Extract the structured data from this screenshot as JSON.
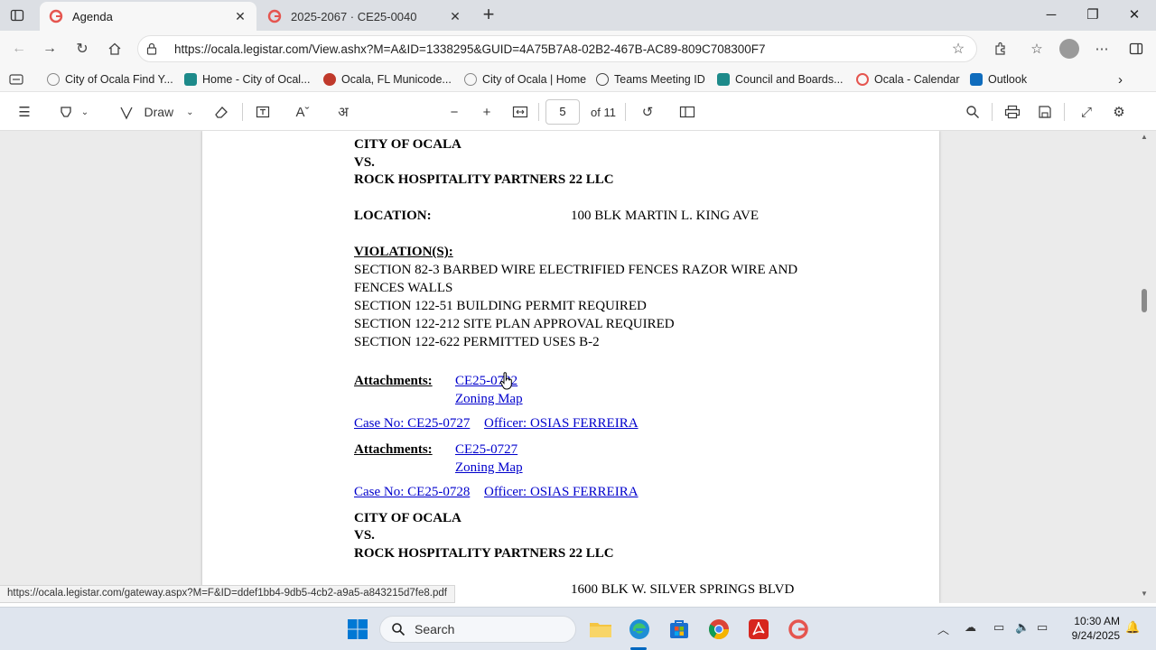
{
  "browser": {
    "tabs": [
      {
        "title": "Agenda",
        "active": true
      },
      {
        "title": "2025-2067 · CE25-0040",
        "active": false
      }
    ],
    "url": "https://ocala.legistar.com/View.ashx?M=A&ID=1338295&GUID=4A75B7A8-02B2-467B-AC89-809C708300F7",
    "favorites": [
      {
        "label": "City of Ocala  Find Y...",
        "icon": "ocala-icon"
      },
      {
        "label": "Home - City of Ocal...",
        "icon": "teams-icon"
      },
      {
        "label": "Ocala, FL  Municode...",
        "icon": "municode-icon"
      },
      {
        "label": "City of Ocala | Home",
        "icon": "ocala-icon"
      },
      {
        "label": "Teams Meeting ID",
        "icon": "globe-icon"
      },
      {
        "label": "Council and Boards...",
        "icon": "teams-icon"
      },
      {
        "label": "Ocala - Calendar",
        "icon": "google-icon"
      },
      {
        "label": "Outlook",
        "icon": "outlook-icon"
      }
    ]
  },
  "pdf_toolbar": {
    "draw_label": "Draw",
    "page_current": "5",
    "page_total": "of 11"
  },
  "document": {
    "case1": {
      "party1": "CITY OF OCALA",
      "vs": "VS.",
      "party2": "ROCK HOSPITALITY PARTNERS 22 LLC",
      "location_label": "LOCATION:",
      "location_value": "100 BLK MARTIN L. KING AVE",
      "violations_label": "VIOLATION(S):",
      "violations": [
        "SECTION 82-3 BARBED WIRE ELECTRIFIED FENCES RAZOR WIRE AND",
        "FENCES WALLS",
        "SECTION 122-51 BUILDING PERMIT REQUIRED",
        "SECTION 122-212 SITE PLAN APPROVAL REQUIRED",
        "SECTION 122-622 PERMITTED USES B-2"
      ],
      "attachments_label": "Attachments:",
      "attachment1": "CE25-0722",
      "attachment2": "Zoning Map"
    },
    "case2": {
      "case_no": "Case No: CE25-0727",
      "officer": "Officer: OSIAS FERREIRA",
      "attachments_label": "Attachments:",
      "attachment1": "CE25-0727",
      "attachment2": "Zoning Map"
    },
    "case3": {
      "case_no": "Case No: CE25-0728",
      "officer": "Officer: OSIAS FERREIRA",
      "party1": "CITY OF OCALA",
      "vs": "VS.",
      "party2": "ROCK HOSPITALITY PARTNERS 22 LLC",
      "location_value": "1600 BLK W. SILVER SPRINGS BLVD"
    }
  },
  "status_url": "https://ocala.legistar.com/gateway.aspx?M=F&ID=ddef1bb4-9db5-4cb2-a9a5-a843215d7fe8.pdf",
  "taskbar": {
    "search_label": "Search",
    "time": "10:30 AM",
    "date": "9/24/2025"
  },
  "colors": {
    "link": "#0000cc",
    "accent": "#0067c0"
  }
}
